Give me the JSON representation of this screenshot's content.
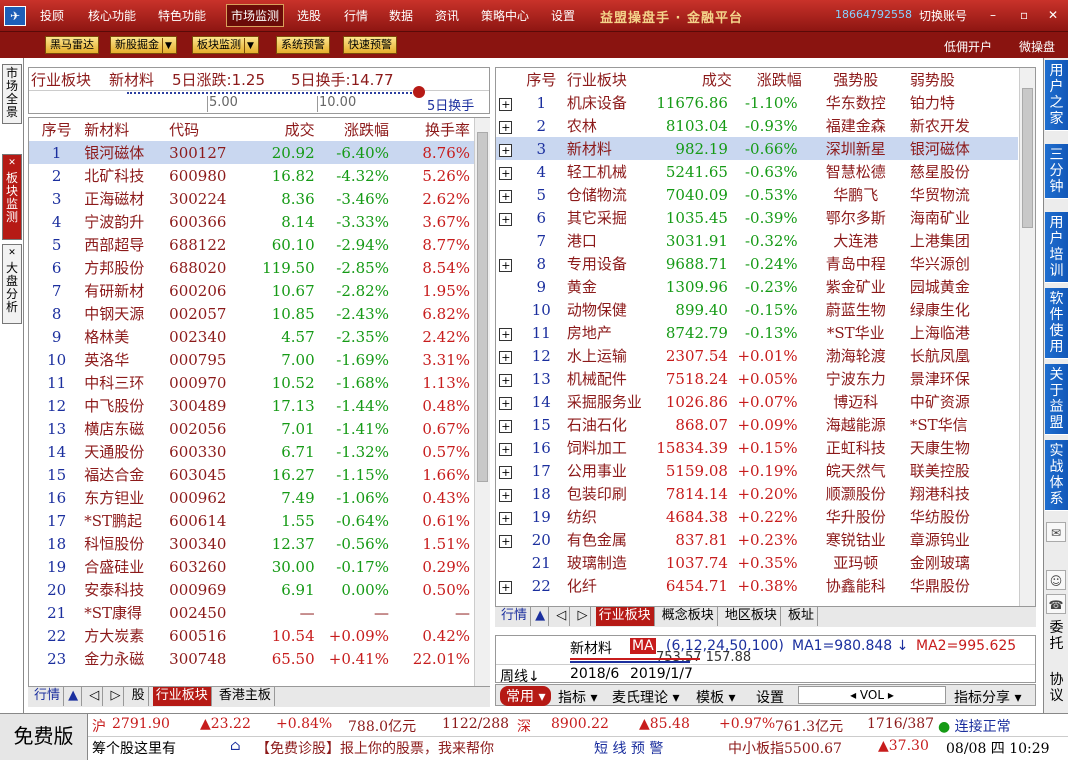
{
  "menu": [
    "投顾",
    "核心功能",
    "特色功能",
    "市场监测",
    "选股",
    "行情",
    "数据",
    "资讯",
    "策略中心",
    "设置"
  ],
  "brand": "益盟操盘手 · 金融平台",
  "phone": "18664792558",
  "switch_account": "切换账号",
  "toolbar": [
    "黑马雷达",
    "新股掘金",
    "板块监测",
    "系统预警",
    "快速预警"
  ],
  "toolbar_right": [
    "低佣开户",
    "微操盘"
  ],
  "left_tabs": [
    "市场全景",
    "板块监测",
    "大盘分析"
  ],
  "right_tabs": [
    "用户之家",
    "三分钟",
    "用户培训",
    "软件使用",
    "关于益盟",
    "实战体系"
  ],
  "right_bottom": [
    "委托",
    "协议"
  ],
  "left_panel": {
    "header_label": "行业板块",
    "header_name": "新材料",
    "header_rise": "5日涨跌:1.25",
    "header_turn": "5日换手:14.77",
    "axis": [
      "5.00",
      "10.00",
      "5日换手"
    ],
    "columns": [
      "序号",
      "新材料",
      "代码",
      "成交",
      "涨跌幅",
      "换手率"
    ],
    "rows": [
      [
        "1",
        "银河磁体",
        "300127",
        "20.92",
        "-6.40%",
        "8.76%"
      ],
      [
        "2",
        "北矿科技",
        "600980",
        "16.82",
        "-4.32%",
        "5.26%"
      ],
      [
        "3",
        "正海磁材",
        "300224",
        "8.36",
        "-3.46%",
        "2.62%"
      ],
      [
        "4",
        "宁波韵升",
        "600366",
        "8.14",
        "-3.33%",
        "3.67%"
      ],
      [
        "5",
        "西部超导",
        "688122",
        "60.10",
        "-2.94%",
        "8.77%"
      ],
      [
        "6",
        "方邦股份",
        "688020",
        "119.50",
        "-2.85%",
        "8.54%"
      ],
      [
        "7",
        "有研新材",
        "600206",
        "10.67",
        "-2.82%",
        "1.95%"
      ],
      [
        "8",
        "中钢天源",
        "002057",
        "10.85",
        "-2.43%",
        "6.82%"
      ],
      [
        "9",
        "格林美",
        "002340",
        "4.57",
        "-2.35%",
        "2.42%"
      ],
      [
        "10",
        "英洛华",
        "000795",
        "7.00",
        "-1.69%",
        "3.31%"
      ],
      [
        "11",
        "中科三环",
        "000970",
        "10.52",
        "-1.68%",
        "1.13%"
      ],
      [
        "12",
        "中飞股份",
        "300489",
        "17.13",
        "-1.44%",
        "0.48%"
      ],
      [
        "13",
        "横店东磁",
        "002056",
        "7.01",
        "-1.41%",
        "0.67%"
      ],
      [
        "14",
        "天通股份",
        "600330",
        "6.71",
        "-1.32%",
        "0.57%"
      ],
      [
        "15",
        "福达合金",
        "603045",
        "16.27",
        "-1.15%",
        "1.66%"
      ],
      [
        "16",
        "东方钽业",
        "000962",
        "7.49",
        "-1.06%",
        "0.43%"
      ],
      [
        "17",
        "*ST鹏起",
        "600614",
        "1.55",
        "-0.64%",
        "0.61%"
      ],
      [
        "18",
        "科恒股份",
        "300340",
        "12.37",
        "-0.56%",
        "1.51%"
      ],
      [
        "19",
        "合盛硅业",
        "603260",
        "30.00",
        "-0.17%",
        "0.29%"
      ],
      [
        "20",
        "安泰科技",
        "000969",
        "6.91",
        "0.00%",
        "0.50%"
      ],
      [
        "21",
        "*ST康得",
        "002450",
        "—",
        "—",
        "—"
      ],
      [
        "22",
        "方大炭素",
        "600516",
        "10.54",
        "+0.09%",
        "0.42%"
      ],
      [
        "23",
        "金力永磁",
        "300748",
        "65.50",
        "+0.41%",
        "22.01%"
      ]
    ],
    "tabs": [
      "行情",
      "股",
      "行业板块",
      "香港主板"
    ]
  },
  "right_panel": {
    "columns": [
      "序号",
      "行业板块",
      "成交",
      "涨跌幅",
      "强势股",
      "弱势股"
    ],
    "rows": [
      [
        "1",
        "机床设备",
        "11676.86",
        "-1.10%",
        "华东数控",
        "铂力特"
      ],
      [
        "2",
        "农林",
        "8103.04",
        "-0.93%",
        "福建金森",
        "新农开发"
      ],
      [
        "3",
        "新材料",
        "982.19",
        "-0.66%",
        "深圳新星",
        "银河磁体"
      ],
      [
        "4",
        "轻工机械",
        "5241.65",
        "-0.63%",
        "智慧松德",
        "慈星股份"
      ],
      [
        "5",
        "仓储物流",
        "7040.09",
        "-0.53%",
        "华鹏飞",
        "华贸物流"
      ],
      [
        "6",
        "其它采掘",
        "1035.45",
        "-0.39%",
        "鄂尔多斯",
        "海南矿业"
      ],
      [
        "7",
        "港口",
        "3031.91",
        "-0.32%",
        "大连港",
        "上港集团"
      ],
      [
        "8",
        "专用设备",
        "9688.71",
        "-0.24%",
        "青岛中程",
        "华兴源创"
      ],
      [
        "9",
        "黄金",
        "1309.96",
        "-0.23%",
        "紫金矿业",
        "园城黄金"
      ],
      [
        "10",
        "动物保健",
        "899.40",
        "-0.15%",
        "蔚蓝生物",
        "绿康生化"
      ],
      [
        "11",
        "房地产",
        "8742.79",
        "-0.13%",
        "*ST华业",
        "上海临港"
      ],
      [
        "12",
        "水上运输",
        "2307.54",
        "+0.01%",
        "渤海轮渡",
        "长航凤凰"
      ],
      [
        "13",
        "机械配件",
        "7518.24",
        "+0.05%",
        "宁波东力",
        "景津环保"
      ],
      [
        "14",
        "采掘服务业",
        "1026.86",
        "+0.07%",
        "博迈科",
        "中矿资源"
      ],
      [
        "15",
        "石油石化",
        "868.07",
        "+0.09%",
        "海越能源",
        "*ST华信"
      ],
      [
        "16",
        "饲料加工",
        "15834.39",
        "+0.15%",
        "正虹科技",
        "天康生物"
      ],
      [
        "17",
        "公用事业",
        "5159.08",
        "+0.19%",
        "皖天然气",
        "联美控股"
      ],
      [
        "18",
        "包装印刷",
        "7814.14",
        "+0.20%",
        "顺灏股份",
        "翔港科技"
      ],
      [
        "19",
        "纺织",
        "4684.38",
        "+0.22%",
        "华升股份",
        "华纺股份"
      ],
      [
        "20",
        "有色金属",
        "837.81",
        "+0.23%",
        "寒锐钴业",
        "章源钨业"
      ],
      [
        "21",
        "玻璃制造",
        "1037.74",
        "+0.35%",
        "亚玛顿",
        "金刚玻璃"
      ],
      [
        "22",
        "化纤",
        "6454.71",
        "+0.38%",
        "协鑫能科",
        "华鼎股份"
      ]
    ],
    "plus_rows": [
      1,
      2,
      3,
      4,
      5,
      6,
      8,
      11,
      12,
      13,
      14,
      15,
      16,
      17,
      18,
      19,
      20,
      22
    ],
    "tabs": [
      "行情",
      "行业板块",
      "概念板块",
      "地区板块",
      "板址"
    ]
  },
  "kline": {
    "name": "新材料",
    "ma": "MA",
    "ma_params": "(6,12,24,50,100)",
    "ma1": "MA1=980.848 ↓",
    "ma2": "MA2=995.625",
    "period": "周线",
    "dates": [
      "2018/6",
      "2019/1/7"
    ],
    "overlay": "753.57 157.88"
  },
  "kbar": {
    "common": "常用",
    "items": [
      "指标",
      "麦氏理论",
      "模板",
      "设置"
    ],
    "vol": "VOL",
    "share": "指标分享"
  },
  "status": {
    "free": "免费版",
    "sh": [
      "沪",
      "2791.90",
      "▲23.22",
      "+0.84%",
      "788.0亿元",
      "1122/288"
    ],
    "sz": [
      "深",
      "8900.22",
      "▲85.48",
      "+0.97%",
      "761.3亿元",
      "1716/387"
    ],
    "conn": "连接正常",
    "ticker": "筹个股这里有",
    "promo": "【免费诊股】报上你的股票，我来帮你",
    "warn": "短 线 预 警",
    "zxb": [
      "中小板指5500.67",
      "▲37.30"
    ],
    "time": "08/08 四 10:29"
  }
}
